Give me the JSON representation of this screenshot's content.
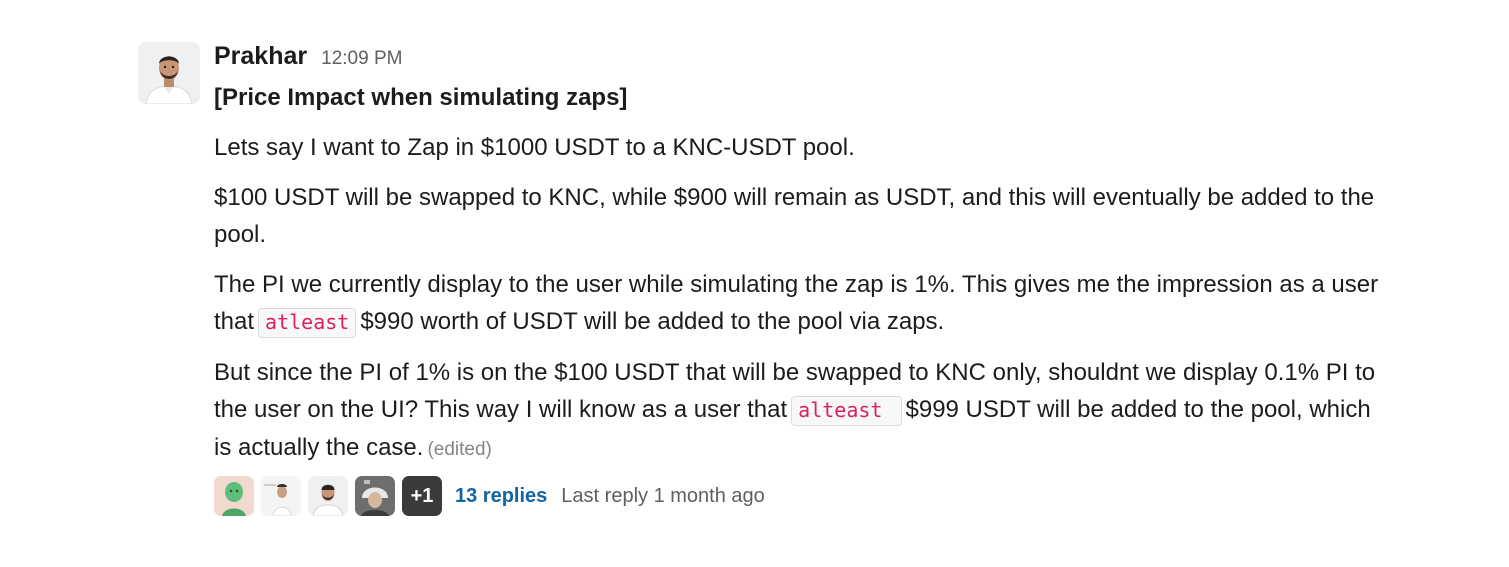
{
  "message": {
    "author": "Prakhar",
    "timestamp": "12:09 PM",
    "title": "[Price Impact when simulating zaps]",
    "paragraphs": {
      "p1": "Lets say I want to Zap in $1000 USDT to a KNC-USDT pool.",
      "p2": "$100 USDT will be swapped to KNC, while $900 will remain as USDT, and this will eventually be added to the pool.",
      "p3_a": "The PI we currently display to the user while simulating the zap is 1%. This gives me the impression as a user that",
      "p3_code": "atleast",
      "p3_b": "$990 worth of USDT will be added to the pool via zaps.",
      "p4_a": "But since the PI of 1% is on the $100 USDT that will be swapped to KNC only, shouldnt we display 0.1% PI to the user on the UI? This way I will know as a user that",
      "p4_code": "alteast ",
      "p4_b": "$999 USDT will be added to the pool, which is actually the case."
    },
    "edited_label": "(edited)"
  },
  "thread": {
    "more_count": "+1",
    "replies_label": "13 replies",
    "last_reply": "Last reply 1 month ago"
  },
  "icons": {
    "author_avatar": "person-avatar-icon",
    "participants": [
      "avatar-green-statue",
      "avatar-person-light",
      "avatar-prakhar",
      "avatar-person-helmet"
    ]
  }
}
